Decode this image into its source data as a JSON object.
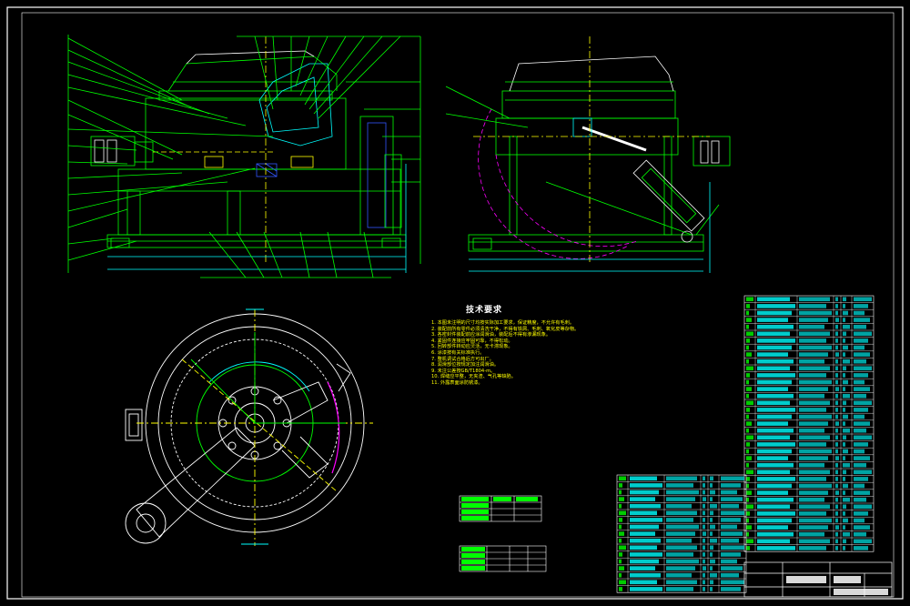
{
  "drawing": {
    "background": "#000000",
    "frame_color": "#ffffff",
    "line_color": "#00ff00",
    "dim_color": "#00ffff",
    "text_color": "#ffff00",
    "accent_color": "#ff00ff",
    "blue_color": "#3355ff"
  },
  "notes": {
    "title": "技术要求",
    "items": [
      "1. 本图未注明的尺寸均按实际加工要求，保证精度，不允许有毛刺。",
      "2. 装配前所有零件必须清洗干净，不得有铁屑、毛刺、氧化皮等杂物。",
      "3. 各密封件装配前应涂润滑油，装配后不得有渗漏现象。",
      "4. 紧固件连接应牢固可靠，不得松动。",
      "5. 回转部件转动应灵活，无卡滞现象。",
      "6. 涂漆按有关标准执行。",
      "7. 整机调试合格后方可出厂。",
      "8. 润滑部位按规定加注润滑油。",
      "9. 未注公差按GB/T1804-m。",
      "10. 焊缝应平整，无夹渣、气孔等缺陷。",
      "11. 外露表面涂防锈漆。"
    ]
  },
  "tables": {
    "small_table_1_title": "主要技术参数",
    "small_table_2_title": "技术特性表"
  },
  "title_block": {
    "label_1": "标准件",
    "label_2": "零件名称",
    "label_3": "比例",
    "label_4": "图号"
  }
}
